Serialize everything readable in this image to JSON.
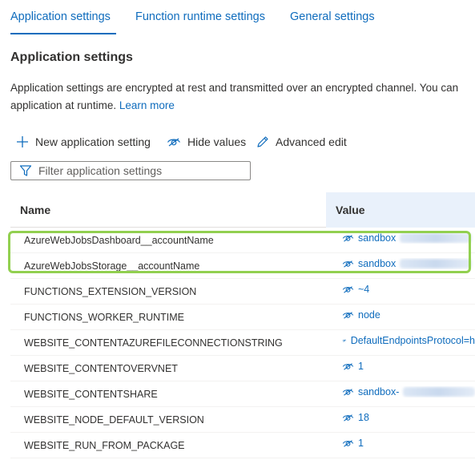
{
  "tabs": [
    {
      "label": "Application settings"
    },
    {
      "label": "Function runtime settings"
    },
    {
      "label": "General settings"
    }
  ],
  "section": {
    "title": "Application settings",
    "desc_line1": "Application settings are encrypted at rest and transmitted over an encrypted channel. You can",
    "desc_line2": "application at runtime.",
    "learn_more": "Learn more"
  },
  "toolbar": {
    "new_label": "New application setting",
    "hide_label": "Hide values",
    "advanced_label": "Advanced edit"
  },
  "filter": {
    "placeholder": "Filter application settings"
  },
  "grid": {
    "col_name": "Name",
    "col_value": "Value",
    "rows": [
      {
        "name": "AzureWebJobsDashboard__accountName",
        "value": "sandbox"
      },
      {
        "name": "AzureWebJobsStorage__accountName",
        "value": "sandbox"
      },
      {
        "name": "FUNCTIONS_EXTENSION_VERSION",
        "value": "~4"
      },
      {
        "name": "FUNCTIONS_WORKER_RUNTIME",
        "value": "node"
      },
      {
        "name": "WEBSITE_CONTENTAZUREFILECONNECTIONSTRING",
        "value": "DefaultEndpointsProtocol=h"
      },
      {
        "name": "WEBSITE_CONTENTOVERVNET",
        "value": "1"
      },
      {
        "name": "WEBSITE_CONTENTSHARE",
        "value": "sandbox-"
      },
      {
        "name": "WEBSITE_NODE_DEFAULT_VERSION",
        "value": "18"
      },
      {
        "name": "WEBSITE_RUN_FROM_PACKAGE",
        "value": "1"
      }
    ]
  },
  "colors": {
    "accent": "#0f6cbd",
    "highlight": "#92d050",
    "header_value_bg": "#e9f1fb"
  },
  "icons": [
    "plus-icon",
    "eye-hide-icon",
    "pencil-icon",
    "filter-icon"
  ]
}
